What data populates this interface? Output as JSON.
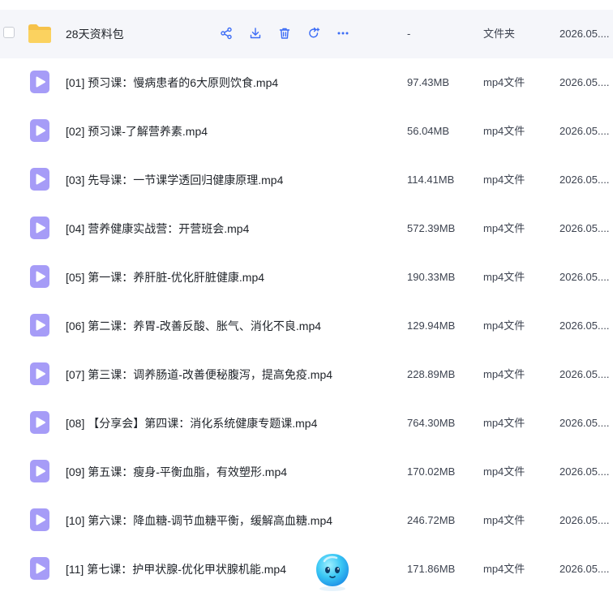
{
  "accent_color": "#3b6cf6",
  "folder_row": {
    "name": "28天资料包",
    "size": "-",
    "type": "文件夹",
    "date": "2026.05....",
    "icon": "folder-icon",
    "actions": [
      {
        "icon": "share-icon"
      },
      {
        "icon": "download-icon"
      },
      {
        "icon": "delete-icon"
      },
      {
        "icon": "rename-icon"
      },
      {
        "icon": "more-icon"
      }
    ]
  },
  "files": [
    {
      "name": "[01] 预习课：慢病患者的6大原则饮食.mp4",
      "size": "97.43MB",
      "type": "mp4文件",
      "date": "2026.05....",
      "icon": "video-file-icon"
    },
    {
      "name": "[02] 预习课-了解营养素.mp4",
      "size": "56.04MB",
      "type": "mp4文件",
      "date": "2026.05....",
      "icon": "video-file-icon"
    },
    {
      "name": "[03] 先导课：一节课学透回归健康原理.mp4",
      "size": "114.41MB",
      "type": "mp4文件",
      "date": "2026.05....",
      "icon": "video-file-icon"
    },
    {
      "name": "[04] 营养健康实战营：开营班会.mp4",
      "size": "572.39MB",
      "type": "mp4文件",
      "date": "2026.05....",
      "icon": "video-file-icon"
    },
    {
      "name": "[05] 第一课：养肝脏-优化肝脏健康.mp4",
      "size": "190.33MB",
      "type": "mp4文件",
      "date": "2026.05....",
      "icon": "video-file-icon"
    },
    {
      "name": "[06] 第二课：养胃-改善反酸、胀气、消化不良.mp4",
      "size": "129.94MB",
      "type": "mp4文件",
      "date": "2026.05....",
      "icon": "video-file-icon"
    },
    {
      "name": "[07] 第三课：调养肠道-改善便秘腹泻，提高免疫.mp4",
      "size": "228.89MB",
      "type": "mp4文件",
      "date": "2026.05....",
      "icon": "video-file-icon"
    },
    {
      "name": "[08] 【分享会】第四课：消化系统健康专题课.mp4",
      "size": "764.30MB",
      "type": "mp4文件",
      "date": "2026.05....",
      "icon": "video-file-icon"
    },
    {
      "name": "[09] 第五课：瘦身-平衡血脂，有效塑形.mp4",
      "size": "170.02MB",
      "type": "mp4文件",
      "date": "2026.05....",
      "icon": "video-file-icon"
    },
    {
      "name": "[10] 第六课：降血糖-调节血糖平衡，缓解高血糖.mp4",
      "size": "246.72MB",
      "type": "mp4文件",
      "date": "2026.05....",
      "icon": "video-file-icon"
    },
    {
      "name": "[11] 第七课：护甲状腺-优化甲状腺机能.mp4",
      "size": "171.86MB",
      "type": "mp4文件",
      "date": "2026.05....",
      "icon": "video-file-icon"
    }
  ],
  "assistant": {
    "icon": "assistant-mascot-icon"
  }
}
